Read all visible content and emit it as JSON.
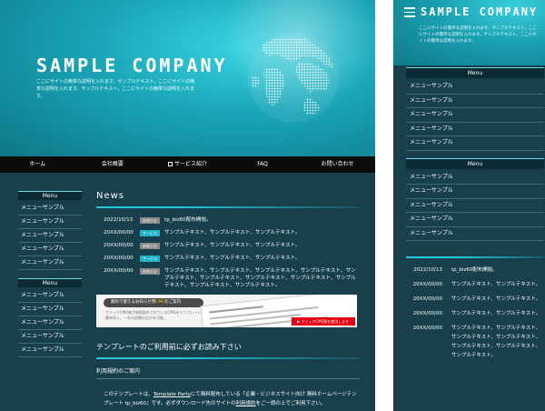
{
  "company": "SAMPLE COMPANY",
  "hero_desc": "ここにサイトの簡単な説明を入れます。サンプルテキスト。ここにサイトの簡単な説明を入れます。サンプルテキスト。ここにサイトの簡単な説明を入れます。",
  "mobile_desc": "ここにサイトの簡単な説明を入れます。サンプルテキスト。ここにサイトの簡単な説明を入れます。サンプルテキスト。ここにサイトの簡単な説明を入れます。",
  "nav": [
    "ホーム",
    "会社概要",
    "サービス紹介",
    "FAQ",
    "お問い合わせ"
  ],
  "menu_heading": "Menu",
  "menu_item": "メニューサンプル",
  "news": {
    "title": "News",
    "items": [
      {
        "date": "2022/10/13",
        "badge": "お知らせ",
        "text": "tp_biz60配布開始。"
      },
      {
        "date": "20XX/00/00",
        "badge": "サービス",
        "text": "サンプルテキスト、サンプルテキスト、サンプルテキスト。"
      },
      {
        "date": "20XX/00/00",
        "badge": "お知らせ",
        "text": "サンプルテキスト、サンプルテキスト、サンプルテキスト。"
      },
      {
        "date": "20XX/00/00",
        "badge": "サービス",
        "text": "サンプルテキスト、サンプルテキスト、サンプルテキスト。"
      },
      {
        "date": "20XX/00/00",
        "badge": "お知らせ",
        "text": "サンプルテキスト、サンプルテキスト、サンプルテキスト、サンプルテキスト、サンプルテキスト、サンプルテキスト、サンプルテキスト、サンプルテキスト、サンプルテキスト、サンプルテキスト、サンプルテキスト。"
      }
    ]
  },
  "banner": {
    "btn_prefix": "無料",
    "btn_middle": "で使えるお知らせ用",
    "btn_highlight": "CMS",
    "btn_suffix": "をご案内",
    "desc": "クイックCMS無が無償配布されているCMSをテンプレートに簡単導入。一年の詳細の出方を可能。",
    "red": "▶ クイックCMS版を使用します"
  },
  "notice": {
    "heading": "テンプレートのご利用前に必ずお読み下さい",
    "sub": "利用規約のご案内",
    "para_prefix": "このテンプレートは、",
    "link1": "Template Party",
    "para_middle": "にて無料配布している『企業・ビジネスサイト向け 無料ホームページテンプレート tp_biz60』です。必ずダウンロード先のサイトの",
    "link2": "利用規約",
    "para_suffix": "をご一読の上でご利用下さい。"
  },
  "mobile_news": [
    {
      "date": "2022/10/13",
      "text": "tp_biz60配布開始。"
    },
    {
      "date": "20XX/00/00",
      "text": "サンプルテキスト、サンプルテキスト。"
    },
    {
      "date": "20XX/00/00",
      "text": "サンプルテキスト、サンプルテキスト。"
    },
    {
      "date": "20XX/00/00",
      "text": "サンプルテキスト、サンプルテキスト。"
    },
    {
      "date": "20XX/00/00",
      "text": "サンプルテキスト、サンプルテキスト、サンプルテキスト、サンプルテキスト、サンプルテキスト、サンプルテキスト、サンプルテキスト。"
    }
  ]
}
